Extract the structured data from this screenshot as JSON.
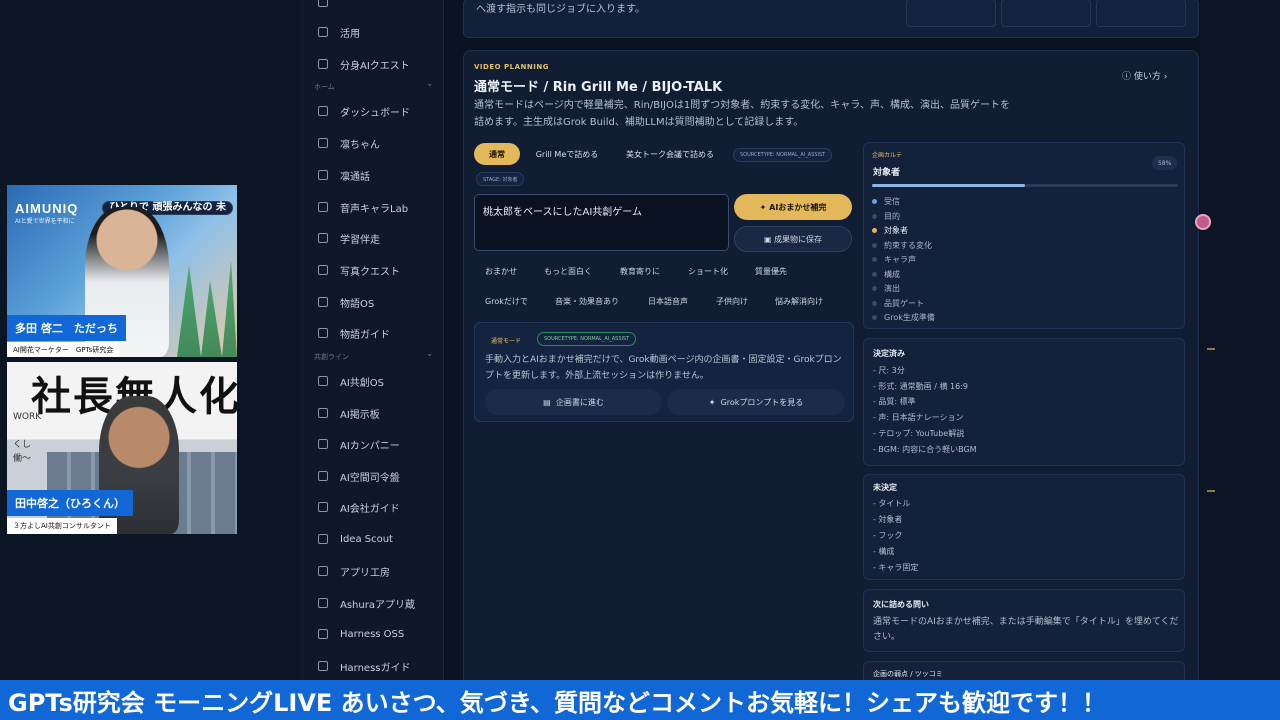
{
  "ticker": "GPTs研究会 モーニングLIVE あいさつ、気づき、質問などコメントお気軽に！シェアも歓迎です！！",
  "video": {
    "tile1": {
      "logo": "AIMUNIQ",
      "logo_sub": "AIと愛で世界を平和に",
      "tag_line1": "ひとりで 頑張",
      "tag_line2": "みんなの 未",
      "name": "多田 啓二　ただっち",
      "role": "AI開花マーケター　GPTs研究会"
    },
    "tile2": {
      "big_text": "社長無人化",
      "side_text": "WORK",
      "side_text2": "くし",
      "side_text3": "働〜",
      "name": "田中啓之（ひろくん）",
      "role": "３方よしAI共創コンサルタント"
    }
  },
  "sidebar": {
    "items_top": [
      {
        "label": "活用",
        "icon": "rocket-icon"
      },
      {
        "label": "分身AIクエスト",
        "icon": "sparkle-icon"
      }
    ],
    "section_home": "ホーム",
    "items_home": [
      {
        "label": "ダッシュボード",
        "icon": "grid-icon"
      },
      {
        "label": "凛ちゃん",
        "icon": "chat-icon"
      },
      {
        "label": "凛通話",
        "icon": "phone-icon"
      },
      {
        "label": "音声キャラLab",
        "icon": "waveform-icon"
      },
      {
        "label": "学習伴走",
        "icon": "book-icon"
      },
      {
        "label": "写真クエスト",
        "icon": "camera-icon"
      },
      {
        "label": "物語OS",
        "icon": "layers-icon"
      },
      {
        "label": "物語ガイド",
        "icon": "book-icon"
      }
    ],
    "section_line": "共創ライン",
    "items_line": [
      {
        "label": "AI共創OS",
        "icon": "sparkle-icon"
      },
      {
        "label": "AI掲示板",
        "icon": "users-icon"
      },
      {
        "label": "AIカンパニー",
        "icon": "building-icon"
      },
      {
        "label": "AI空間司令盤",
        "icon": "gauge-icon"
      },
      {
        "label": "AI会社ガイド",
        "icon": "book-icon"
      },
      {
        "label": "Idea Scout",
        "icon": "bulb-icon"
      },
      {
        "label": "アプリ工房",
        "icon": "folder-icon"
      },
      {
        "label": "Ashuraアプリ蔵",
        "icon": "box-icon"
      },
      {
        "label": "Harness OSS",
        "icon": "sparkle-icon"
      },
      {
        "label": "Harnessガイド",
        "icon": "book-icon"
      }
    ]
  },
  "top_card": {
    "line1": "",
    "line2": "へ渡す指示も同じジョブに入ります。"
  },
  "panel": {
    "eyebrow": "VIDEO PLANNING",
    "title": "通常モード / Rin Grill Me / BIJO-TALK",
    "description": "通常モードはページ内で軽量補完、Rin/BIJOは1問ずつ対象者、約束する変化、キャラ、声、構成、演出、品質ゲートを詰めます。主生成はGrok Build、補助LLMは質問補助として記録します。",
    "howto": "使い方",
    "modes": [
      "通常",
      "Grill Meで詰める",
      "美女トーク会議で詰める"
    ],
    "active_mode": "通常",
    "tag_source": "SOURCETYPE: NORMAL_AI_ASSIST",
    "tag_stage": "STAGE: 対象者",
    "input_value": "桃太郎をベースにしたAI共創ゲーム",
    "btn_ai_fill": "AIおまかせ補完",
    "btn_save": "成果物に保存",
    "chips_row1": [
      "おまかせ",
      "もっと面白く",
      "教育寄りに",
      "ショート化",
      "質量優先"
    ],
    "chips_row2": [
      "Grokだけで",
      "音楽・効果音あり",
      "日本語音声",
      "子供向け",
      "悩み解消向け"
    ],
    "sub": {
      "mode_tag": "通常モード",
      "source_tag": "SOURCETYPE: NORMAL_AI_ASSIST",
      "description": "手動入力とAIおまかせ補完だけで、Grok動画ページ内の企画書・固定設定・Grokプロンプトを更新します。外部上流セッションは作りません。",
      "btn_plan": "企画書に進む",
      "btn_prompt": "Grokプロンプトを見る"
    }
  },
  "karte": {
    "kicker": "企画カルテ",
    "title": "対象者",
    "percent": "58%",
    "progress": 0.5,
    "steps": [
      {
        "label": "受信",
        "state": "active"
      },
      {
        "label": "目的",
        "state": "todo"
      },
      {
        "label": "対象者",
        "state": "current"
      },
      {
        "label": "約束する変化",
        "state": "todo"
      },
      {
        "label": "キャラ声",
        "state": "todo"
      },
      {
        "label": "構成",
        "state": "todo"
      },
      {
        "label": "演出",
        "state": "todo"
      },
      {
        "label": "品質ゲート",
        "state": "todo"
      },
      {
        "label": "Grok生成準備",
        "state": "todo"
      }
    ]
  },
  "decided": {
    "title": "決定済み",
    "items": [
      "- 尺: 3分",
      "- 形式: 通常動画 / 横 16:9",
      "- 品質: 標準",
      "- 声: 日本語ナレーション",
      "- テロップ: YouTube解説",
      "- BGM: 内容に合う軽いBGM"
    ]
  },
  "undecided": {
    "title": "未決定",
    "items": [
      "- タイトル",
      "- 対象者",
      "- フック",
      "- 構成",
      "- キャラ固定"
    ]
  },
  "next_question": {
    "title": "次に詰める問い",
    "text": "通常モードのAIおまかせ補完、または手動編集で「タイトル」を埋めてください。"
  },
  "weak_points": {
    "title": "企画の弱点 / ツッコミ"
  },
  "colors": {
    "accent": "#e2b85a",
    "ticker": "#1267d6",
    "panel": "#111d33"
  }
}
